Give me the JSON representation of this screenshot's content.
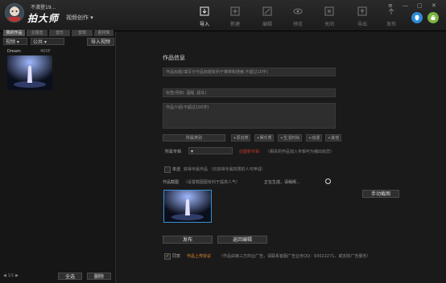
{
  "app": {
    "brand": "拍大师",
    "username": "不満登19...",
    "mode": "视频创作"
  },
  "toolbar": {
    "items": [
      {
        "label": "导入",
        "icon": "import-icon",
        "active": true
      },
      {
        "label": "新建",
        "icon": "new-icon",
        "active": false
      },
      {
        "label": "编辑",
        "icon": "edit-icon",
        "active": false
      },
      {
        "label": "预览",
        "icon": "preview-icon",
        "active": false
      },
      {
        "label": "关闭",
        "icon": "close-icon",
        "active": false
      },
      {
        "label": "导出",
        "icon": "export-icon",
        "active": false
      },
      {
        "label": "发布",
        "icon": "upload-icon",
        "active": false
      }
    ]
  },
  "sidebar": {
    "tabs": [
      "我的作品",
      "主题音",
      "音乐",
      "音效",
      "素材库"
    ],
    "type_select": "视频",
    "filter_select": "公共",
    "import_button": "导入视频",
    "video": {
      "name": "Dream",
      "size": "400P"
    },
    "page": "1/1",
    "select_all": "全选",
    "delete": "删除"
  },
  "form": {
    "section_title": "作品信息",
    "title_placeholder": "作品标题(填写分作品标题有利于推荐和搜索,不超过10字)",
    "tags_placeholder": "标签(例如: 酒醒, 超车)",
    "desc_placeholder": "作品介绍(不超过100字)",
    "category_label": "所属类别",
    "categories": [
      "+原创类",
      "+娱乐秀",
      "+生活时尚",
      "+动漫",
      "+其他"
    ],
    "album_label": "所属专辑",
    "create_album": "创建新专辑",
    "album_hint": "（相关的作品加入专辑可为播出给您）",
    "private_checkbox": "单选",
    "private_label": "获得专属作品 （仅获得专属权限的人可申请）",
    "cover_label": "作品截图",
    "cover_hint": "（设置截图图有利于提高人气）",
    "generating": "正在生成，请稍候...",
    "manual_capture": "手动截图",
    "publish_button": "发布",
    "back_button": "返回编辑",
    "agree_label": "同意",
    "agreement_link": "作品上传协议",
    "notice": "（作品由第三方商业广告，请联系客服广告业务QQ：93022271，或去除广告服务）"
  },
  "colors": {
    "accent_red": "#c0392b",
    "link_orange": "#e08a2c",
    "android_green": "#7cb342",
    "apple_blue": "#2e8bd6"
  }
}
